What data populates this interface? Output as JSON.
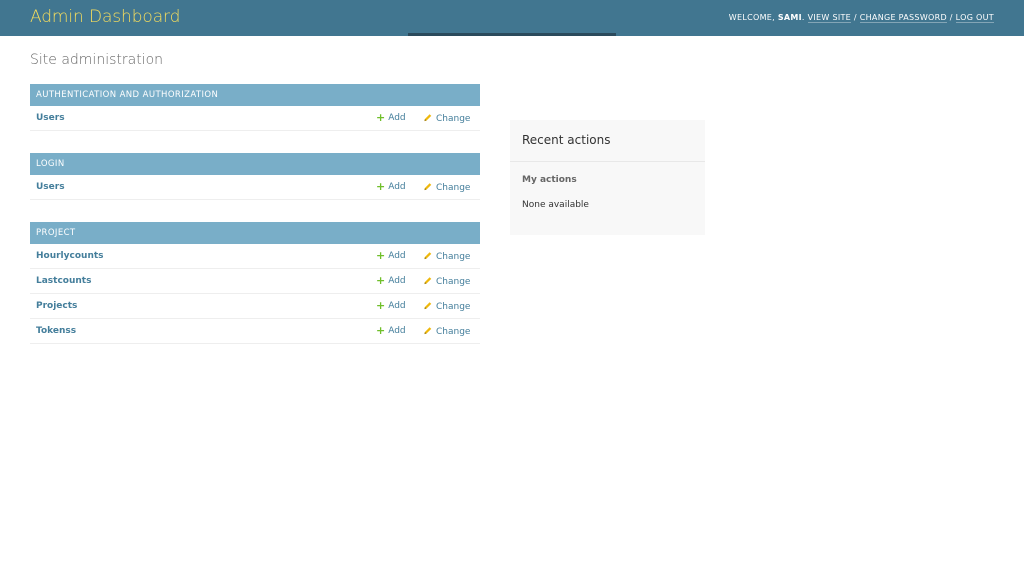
{
  "header": {
    "title": "Admin Dashboard",
    "welcome": "Welcome,",
    "username": "sami",
    "view_site": "View site",
    "change_password": "Change password",
    "log_out": "Log out",
    "separator": "/",
    "period": "."
  },
  "page_title": "Site administration",
  "modules": [
    {
      "caption": "Authentication and Authorization",
      "models": [
        {
          "name": "Users",
          "add": "Add",
          "change": "Change"
        }
      ]
    },
    {
      "caption": "Login",
      "models": [
        {
          "name": "Users",
          "add": "Add",
          "change": "Change"
        }
      ]
    },
    {
      "caption": "Project",
      "models": [
        {
          "name": "Hourlycounts",
          "add": "Add",
          "change": "Change"
        },
        {
          "name": "Lastcounts",
          "add": "Add",
          "change": "Change"
        },
        {
          "name": "Projects",
          "add": "Add",
          "change": "Change"
        },
        {
          "name": "Tokenss",
          "add": "Add",
          "change": "Change"
        }
      ]
    }
  ],
  "recent_actions": {
    "title": "Recent actions",
    "my_actions": "My actions",
    "empty": "None available"
  },
  "icons": {
    "add": "plus-icon",
    "change": "pencil-icon"
  },
  "colors": {
    "header_bg": "#417690",
    "brand": "#f5dd5d",
    "caption_bg": "#79aec8",
    "link": "#447e9b",
    "add_icon": "#70bf2b",
    "change_icon": "#efb80b"
  }
}
